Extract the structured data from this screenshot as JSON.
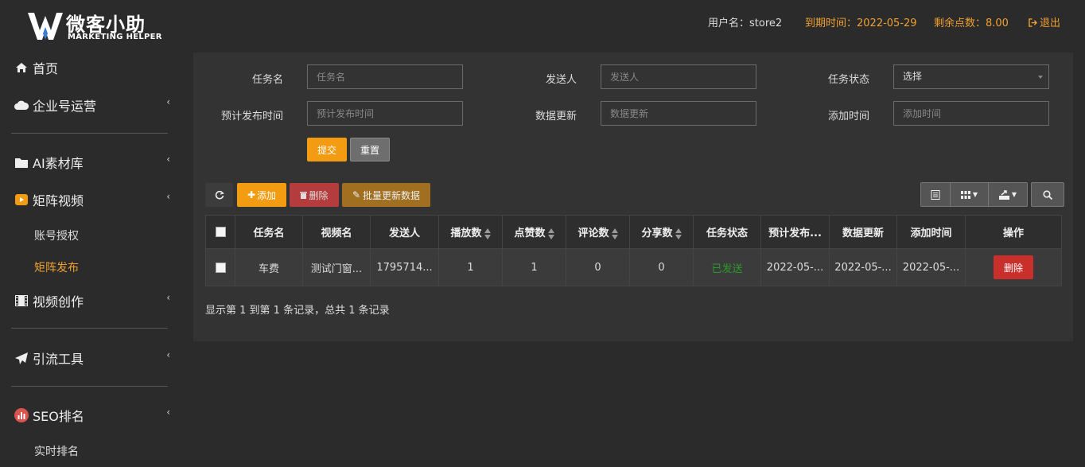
{
  "brand": {
    "title": "微客小助",
    "subtitle": "MARKETING HELPER"
  },
  "header": {
    "username": "用户名：store2",
    "expiry": "到期时间：2022-05-29",
    "points": "剩余点数：8.00",
    "logout": "退出"
  },
  "sidebar": {
    "items": [
      {
        "label": "首页",
        "icon": "home-icon"
      },
      {
        "label": "企业号运营",
        "icon": "cloud-icon"
      },
      {
        "label": "AI素材库",
        "icon": "folder-icon"
      },
      {
        "label": "矩阵视频",
        "icon": "video-icon"
      },
      {
        "label": "视频创作",
        "icon": "film-icon"
      },
      {
        "label": "引流工具",
        "icon": "send-icon"
      },
      {
        "label": "SEO排名",
        "icon": "chart-icon"
      }
    ],
    "sub_items": [
      {
        "label": "账号授权",
        "active": false
      },
      {
        "label": "矩阵发布",
        "active": true
      },
      {
        "label": "实时排名",
        "active": false
      }
    ]
  },
  "filters": {
    "task_name": {
      "label": "任务名",
      "placeholder": "任务名"
    },
    "sender": {
      "label": "发送人",
      "placeholder": "发送人"
    },
    "task_status": {
      "label": "任务状态",
      "value": "选择"
    },
    "planned_time": {
      "label": "预计发布时间",
      "placeholder": "预计发布时间"
    },
    "data_update": {
      "label": "数据更新",
      "placeholder": "数据更新"
    },
    "add_time": {
      "label": "添加时间",
      "placeholder": "添加时间"
    },
    "submit": "提交",
    "reset": "重置"
  },
  "toolbar": {
    "add": "添加",
    "delete": "删除",
    "batch_update": "批量更新数据"
  },
  "table": {
    "headers": [
      "任务名",
      "视频名",
      "发送人",
      "播放数",
      "点赞数",
      "评论数",
      "分享数",
      "任务状态",
      "预计发布...",
      "数据更新",
      "添加时间",
      "操作"
    ],
    "rows": [
      {
        "task_name": "车费",
        "video_name": "测试门窗...",
        "sender": "1795714...",
        "plays": "1",
        "likes": "1",
        "comments": "0",
        "shares": "0",
        "status": "已发送",
        "planned": "2022-05-...",
        "updated": "2022-05-...",
        "added": "2022-05-...",
        "action": "删除"
      }
    ]
  },
  "pagination": {
    "info": "显示第 1 到第 1 条记录，总共 1 条记录"
  },
  "colors": {
    "accent": "#f39c12",
    "danger": "#c9302c",
    "success": "#2a9a2a"
  }
}
